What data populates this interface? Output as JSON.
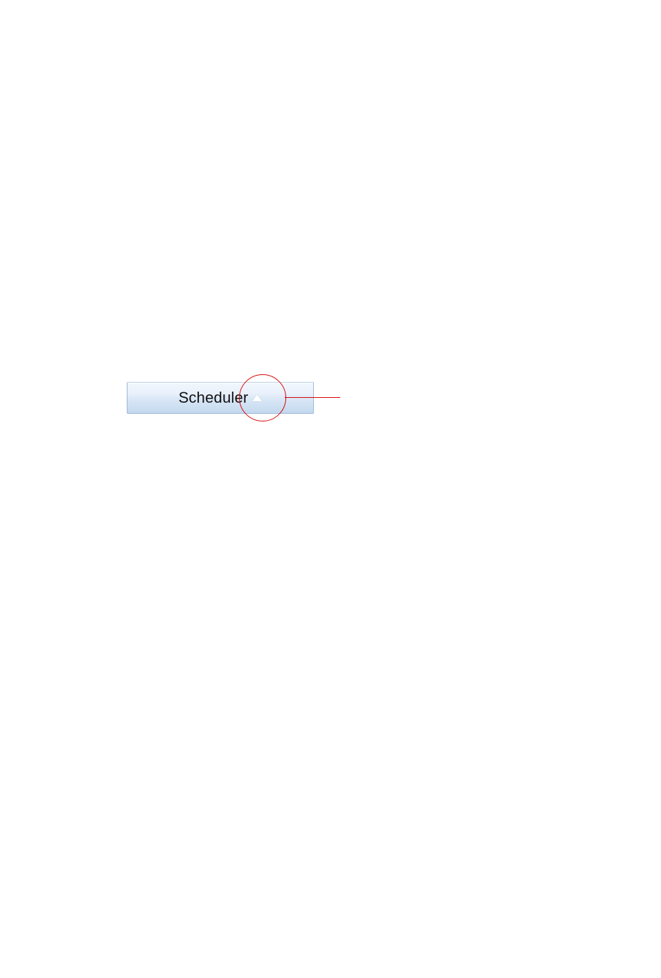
{
  "header": {
    "scheduler_label": "Scheduler",
    "sort_direction": "ascending"
  },
  "annotation": {
    "circle_color": "#d80000",
    "line_color": "#d80000"
  }
}
